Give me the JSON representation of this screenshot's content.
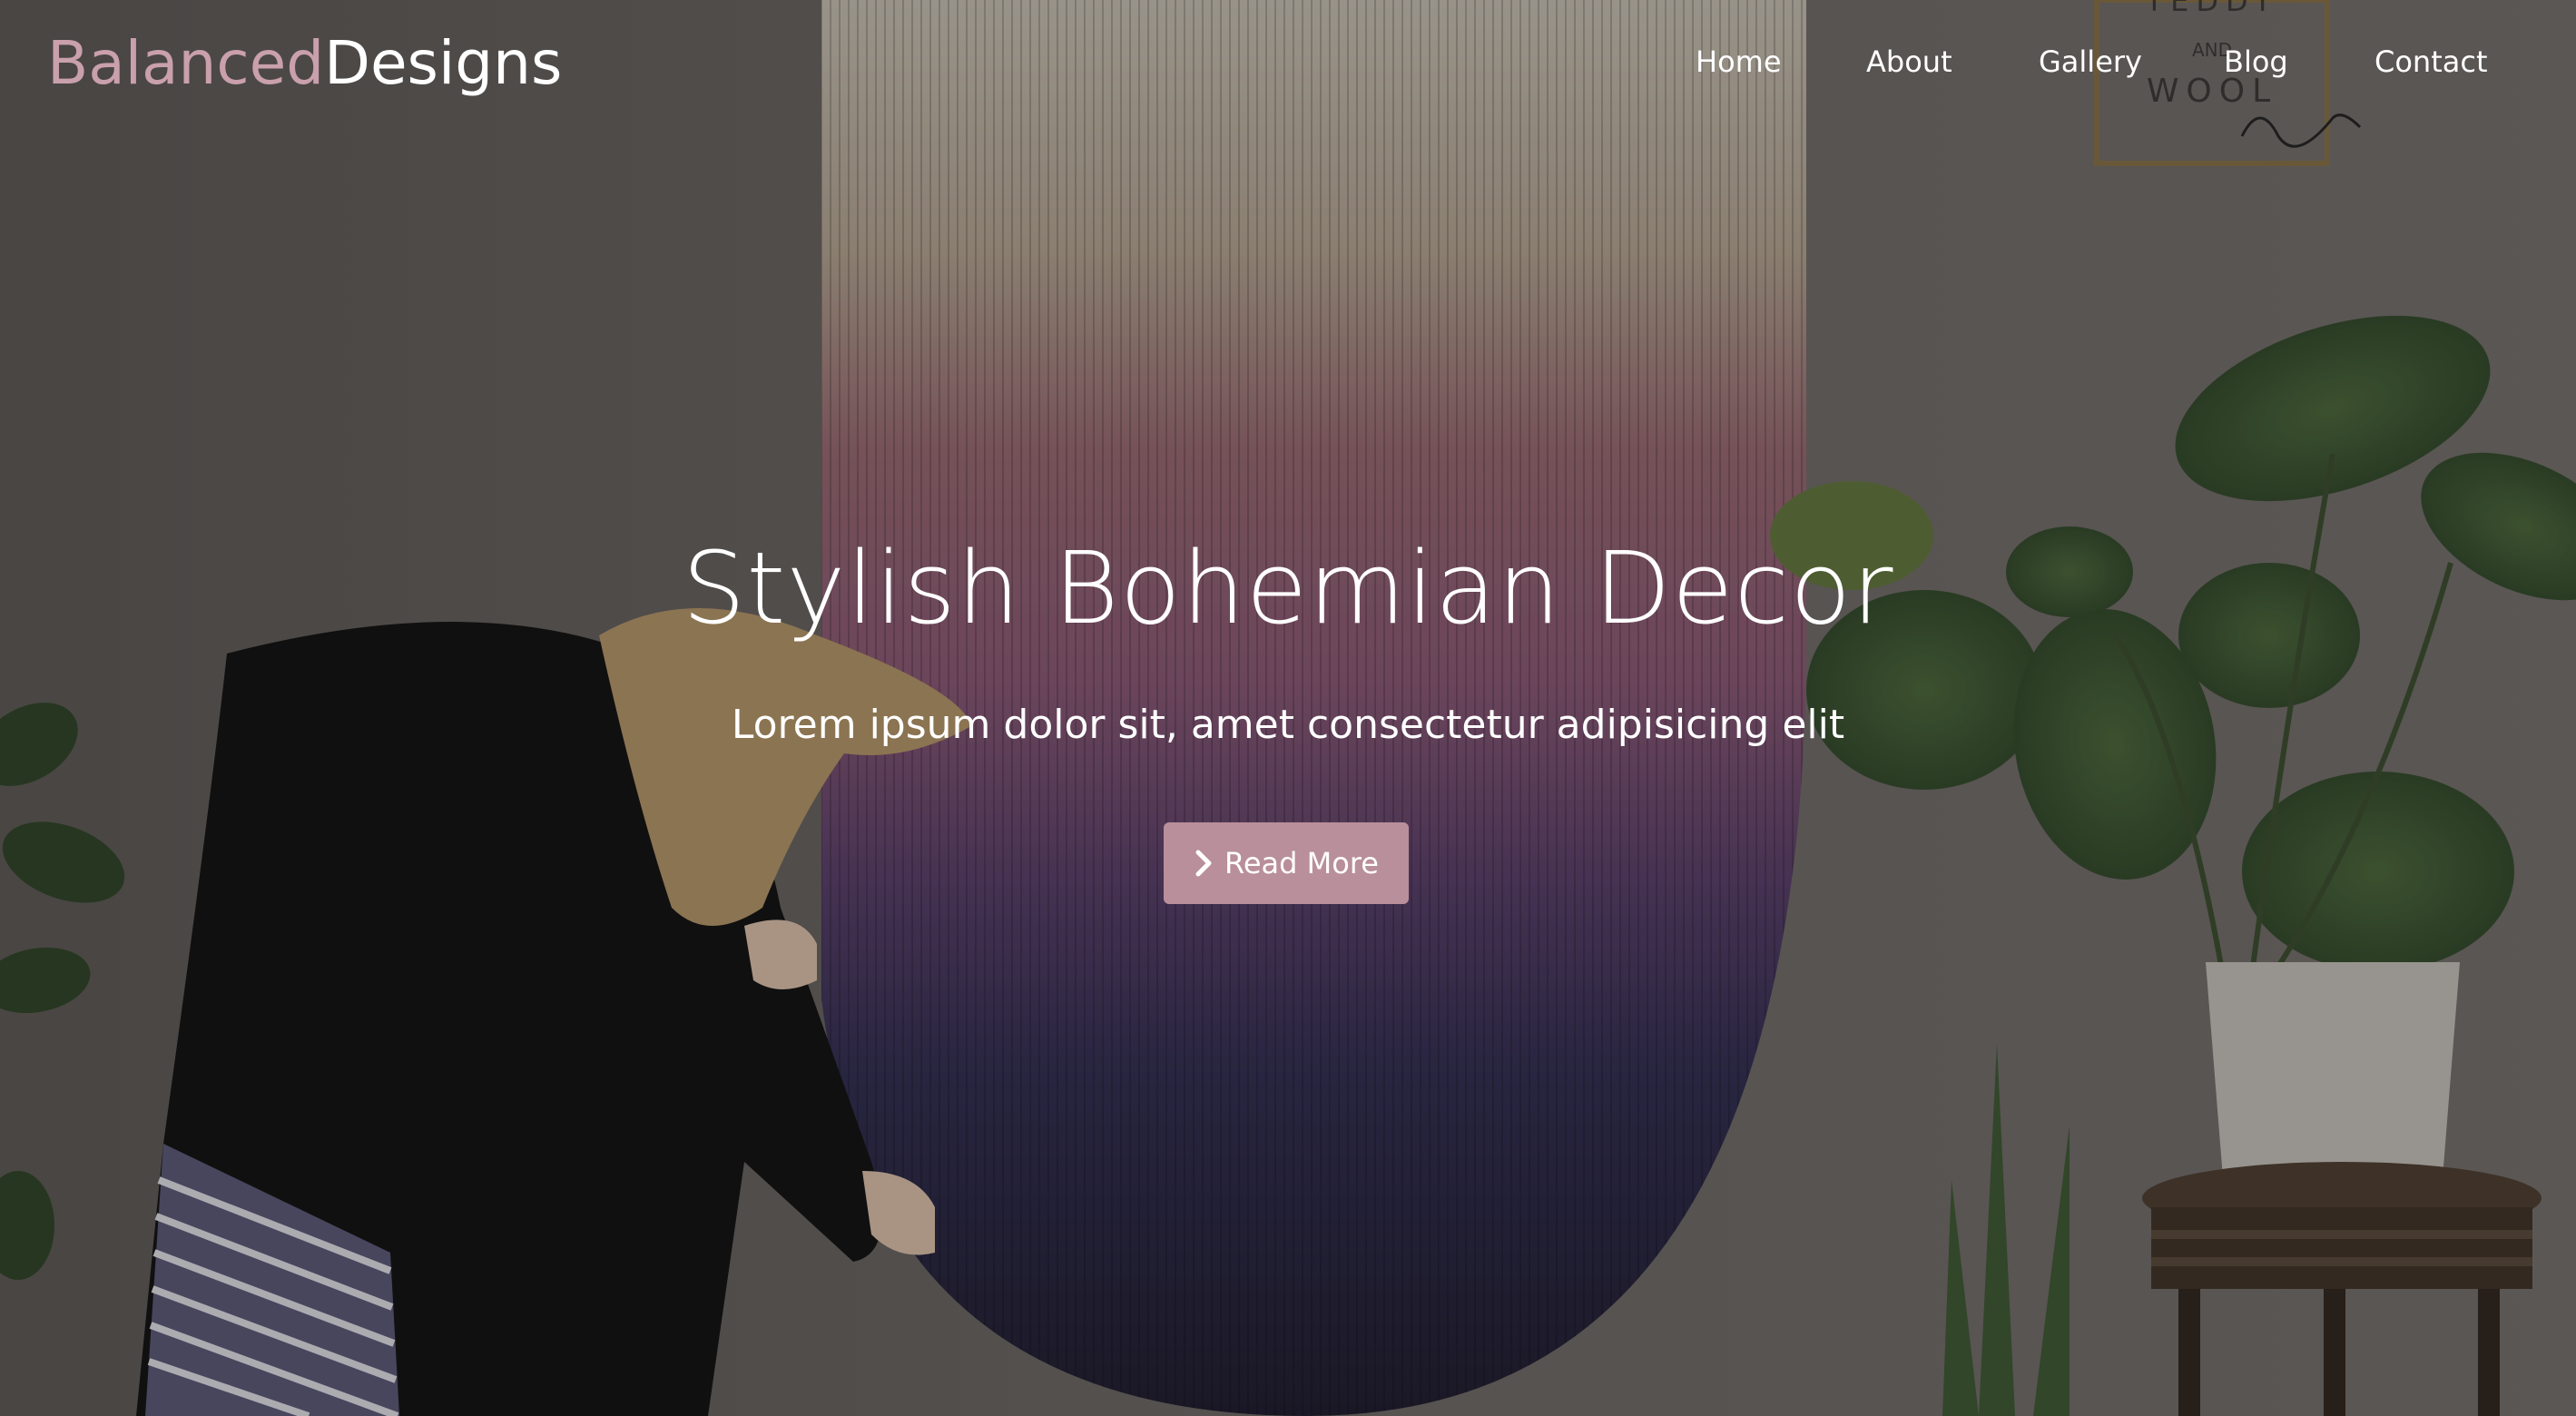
{
  "brand": {
    "part1": "Balanced",
    "part2": "Designs"
  },
  "nav": {
    "items": [
      "Home",
      "About",
      "Gallery",
      "Blog",
      "Contact"
    ]
  },
  "hero": {
    "title": "Stylish Bohemian Decor",
    "subtitle": "Lorem ipsum dolor sit, amet consectetur adipisicing elit",
    "button_label": "Read More",
    "button_icon": "chevron-right-icon"
  },
  "colors": {
    "accent": "#c9a0ac",
    "button": "#b98f9b",
    "text": "#ffffff"
  }
}
